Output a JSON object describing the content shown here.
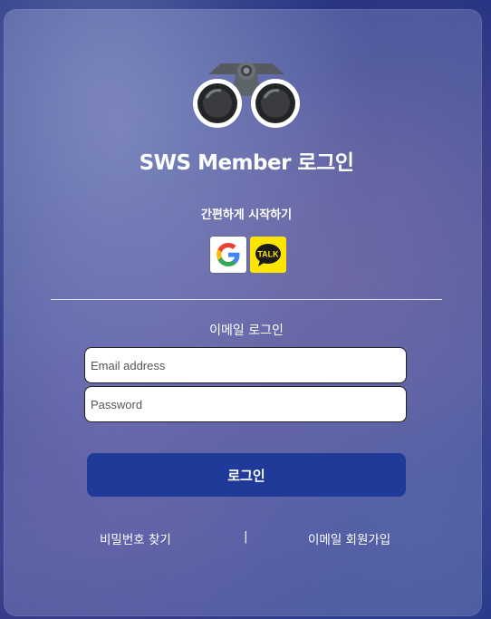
{
  "login": {
    "title": "SWS Member 로그인",
    "quick_start_label": "간편하게 시작하기",
    "social_buttons": [
      {
        "name": "google",
        "icon": "google-logo-icon"
      },
      {
        "name": "kakao",
        "icon": "kakaotalk-logo-icon",
        "label": "TALK"
      }
    ],
    "email_login_label": "이메일 로그인",
    "email_placeholder": "Email address",
    "password_placeholder": "Password",
    "login_button_label": "로그인",
    "find_password_label": "비밀번호 찾기",
    "separator": "|",
    "signup_label": "이메일 회원가입"
  },
  "colors": {
    "primary_button": "#1f3a98",
    "kakao_yellow": "#fde500"
  }
}
